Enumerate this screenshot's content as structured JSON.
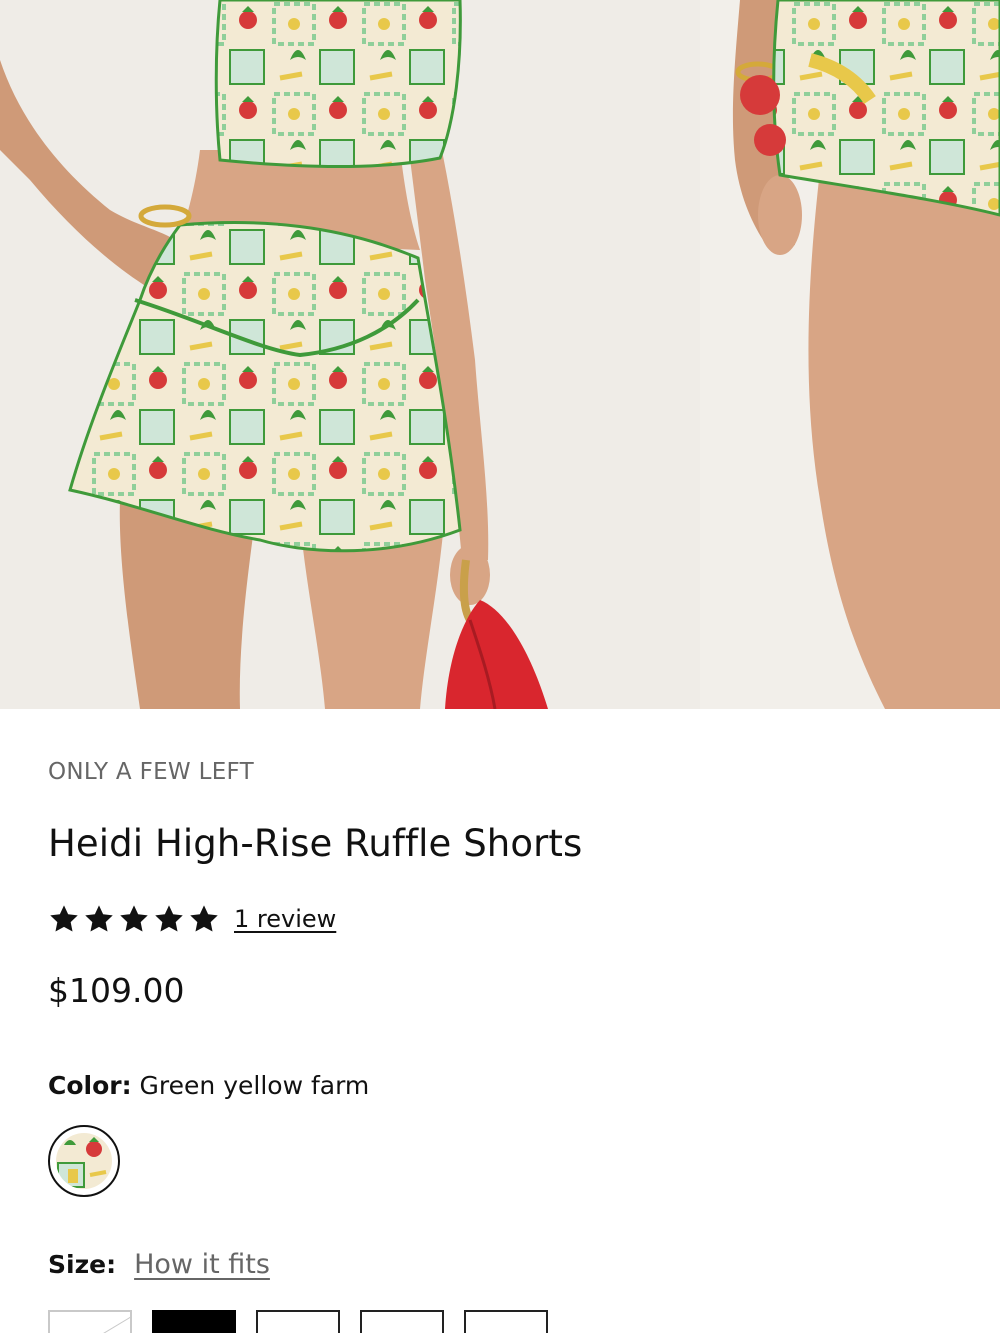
{
  "gallery": {
    "images": [
      {
        "alt": ""
      },
      {
        "alt": ""
      }
    ]
  },
  "product": {
    "stock_note": "ONLY A FEW LEFT",
    "title": "Heidi High-Rise Ruffle Shorts",
    "rating": {
      "stars": 5,
      "max": 5,
      "review_link": "1 review"
    },
    "price": "$109.00",
    "color": {
      "label": "Color:",
      "value": "Green yellow farm"
    },
    "size": {
      "label": "Size:",
      "fit_link": "How it fits",
      "options": [
        {
          "label": "",
          "state": "unavailable"
        },
        {
          "label": "",
          "state": "selected"
        },
        {
          "label": "",
          "state": "available"
        },
        {
          "label": "",
          "state": "available"
        },
        {
          "label": "",
          "state": "available"
        }
      ]
    }
  },
  "colors": {
    "text": "#111111",
    "muted": "#666666",
    "print_cream": "#f3ead3",
    "print_green": "#3f9a3a",
    "print_yellow": "#e8c84a",
    "strawberry_red": "#d63a3a",
    "bag_red": "#d9262e",
    "skin": "#d8a585"
  }
}
